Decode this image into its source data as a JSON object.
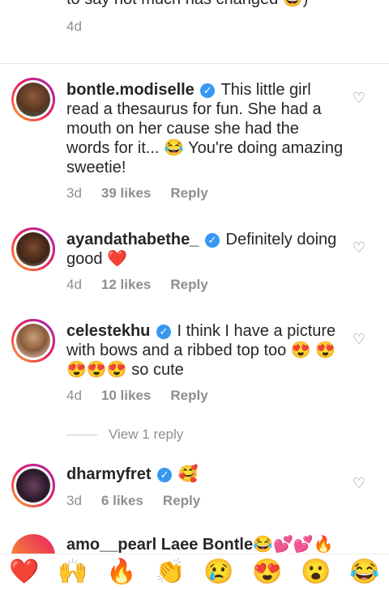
{
  "top_comment": {
    "text": "to say not much has changed 😄)",
    "time": "4d"
  },
  "comments": [
    {
      "username": "bontle.modiselle",
      "text": "This little girl read a thesaurus for fun. She had a mouth on her cause she had the words for it... 😂 You're doing amazing sweetie!",
      "time": "3d",
      "likes": "39 likes",
      "reply": "Reply"
    },
    {
      "username": "ayandathabethe_",
      "text": "Definitely doing good ❤️",
      "time": "4d",
      "likes": "12 likes",
      "reply": "Reply"
    },
    {
      "username": "celestekhu",
      "text": "I think I have a picture with bows and a ribbed top too 😍 😍😍😍😍 so cute",
      "time": "4d",
      "likes": "10 likes",
      "reply": "Reply"
    },
    {
      "username": "dharmyfret",
      "text": "🥰",
      "time": "3d",
      "likes": "6 likes",
      "reply": "Reply"
    }
  ],
  "view_replies": "View 1 reply",
  "partial_comment": "amo__pearl Laee Bontle😂💕💕🔥",
  "emoji_bar": [
    "❤️",
    "🙌",
    "🔥",
    "👏",
    "😢",
    "😍",
    "😮",
    "😂"
  ],
  "icons": {
    "verified": "verified-badge-icon",
    "like": "heart-outline-icon"
  },
  "colors": {
    "verified": "#3897f0",
    "meta": "#8e8e8e"
  }
}
